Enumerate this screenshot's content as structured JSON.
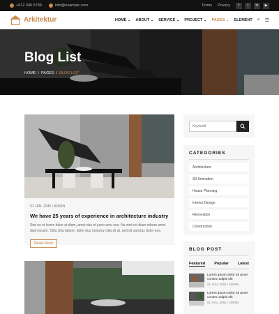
{
  "topbar": {
    "phone": "+012 345 6789",
    "email": "info@example.com",
    "links": [
      "Terms",
      "Privacy"
    ],
    "social": [
      "f",
      "t",
      "in",
      "▶"
    ]
  },
  "navbar": {
    "logo": "Arkitektur",
    "menu": [
      {
        "label": "HOME ⌄",
        "active": false
      },
      {
        "label": "ABOUT ⌄",
        "active": false
      },
      {
        "label": "SERVICE ⌄",
        "active": false
      },
      {
        "label": "PROJECT ⌄",
        "active": false
      },
      {
        "label": "PAGES ⌄",
        "active": true
      },
      {
        "label": "ELEMENT",
        "active": false
      }
    ],
    "search_icon": "⌕",
    "menu_icon": "☰"
  },
  "hero": {
    "title": "Blog List",
    "breadcrumb": [
      "HOME",
      "/",
      "PAGES",
      "/",
      "BLOG LIST"
    ]
  },
  "posts": [
    {
      "meta": "01 JAN, 2045  /  ADMIN",
      "title": "We have 25 years of experience in architecture industry",
      "excerpt": "Stet no et lorem dolor et diam, amet duo et justo vero eos. No stet est diam rebum amet diam ipsum. Clita clita labore, dolor duo nonumy clita sit at, sed sit sanctus dolor eos.",
      "cta": "Read More"
    }
  ],
  "sidebar": {
    "search_placeholder": "Keyword",
    "categories_title": "CATEGORIES",
    "categories": [
      "Architecture",
      "3D Animation",
      "House Planning",
      "Interior Design",
      "Renovation",
      "Construction"
    ],
    "blogpost_title": "BLOG POST",
    "tabs": [
      "Featured",
      "Popular",
      "Latest"
    ],
    "items": [
      {
        "title": "Lorem ipsum dolor sit amet consec adipis elit",
        "meta": "01 JAN, 2045  /  ADMIN"
      },
      {
        "title": "Lorem ipsum dolor sit amet consec adipis elit",
        "meta": "01 JAN, 2045  /  ADMIN"
      }
    ]
  },
  "colors": {
    "accent": "#c98a4b",
    "dark": "#111111",
    "panel": "#f6f6f6"
  }
}
